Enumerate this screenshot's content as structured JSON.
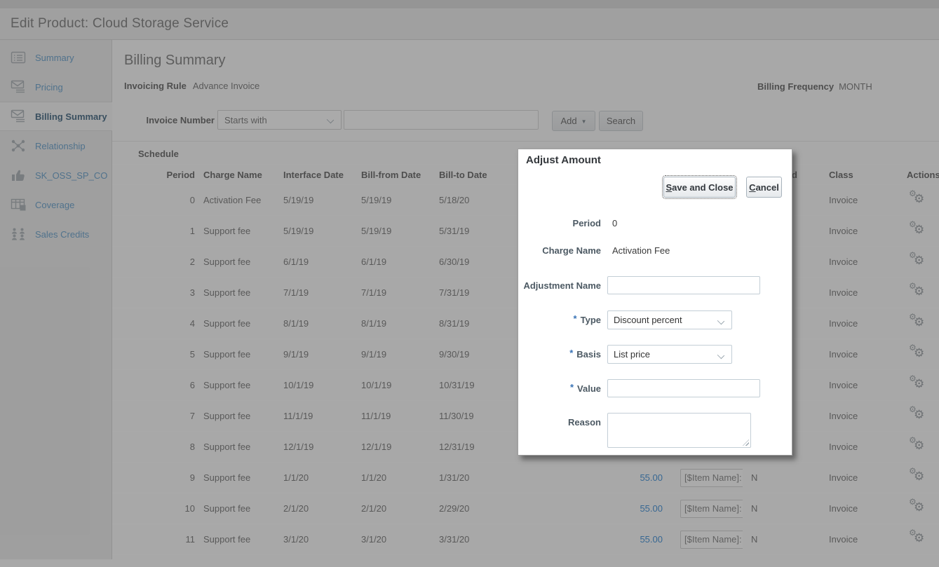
{
  "header": {
    "title": "Edit Product: Cloud Storage Service"
  },
  "sidebar": {
    "items": [
      {
        "label": "Summary",
        "icon": "summary-icon",
        "selected": false
      },
      {
        "label": "Pricing",
        "icon": "pricing-icon",
        "selected": false
      },
      {
        "label": "Billing Summary",
        "icon": "billing-summary-icon",
        "selected": true
      },
      {
        "label": "Relationship",
        "icon": "relationship-icon",
        "selected": false
      },
      {
        "label": "SK_OSS_SP_CO",
        "icon": "thumbs-up-icon",
        "selected": false
      },
      {
        "label": "Coverage",
        "icon": "coverage-icon",
        "selected": false
      },
      {
        "label": "Sales Credits",
        "icon": "sales-credits-icon",
        "selected": false
      }
    ]
  },
  "page": {
    "title": "Billing Summary",
    "invoicing_rule_label": "Invoicing Rule",
    "invoicing_rule_value": "Advance Invoice",
    "billing_frequency_label": "Billing Frequency",
    "billing_frequency_value": "MONTH"
  },
  "search": {
    "field_label": "Invoice Number",
    "operator_value": "Starts with",
    "input_value": "",
    "add_label": "Add",
    "search_label": "Search"
  },
  "schedule": {
    "section_title": "Schedule",
    "columns": {
      "period": "Period",
      "charge_name": "Charge Name",
      "interface_date": "Interface Date",
      "bill_from": "Bill-from Date",
      "bill_to": "Bill-to Date",
      "amount": "",
      "item": "",
      "invoiced": "Invoiced",
      "row_class": "Class",
      "actions": "Actions"
    },
    "rows": [
      {
        "period": "0",
        "charge": "Activation Fee",
        "interface_date": "5/19/19",
        "bill_from": "5/19/19",
        "bill_to": "5/18/20",
        "amount": "",
        "item": "",
        "invoiced": "",
        "row_class": "Invoice"
      },
      {
        "period": "1",
        "charge": "Support fee",
        "interface_date": "5/19/19",
        "bill_from": "5/19/19",
        "bill_to": "5/31/19",
        "amount": "",
        "item": "",
        "invoiced": "",
        "row_class": "Invoice"
      },
      {
        "period": "2",
        "charge": "Support fee",
        "interface_date": "6/1/19",
        "bill_from": "6/1/19",
        "bill_to": "6/30/19",
        "amount": "",
        "item": "",
        "invoiced": "",
        "row_class": "Invoice"
      },
      {
        "period": "3",
        "charge": "Support fee",
        "interface_date": "7/1/19",
        "bill_from": "7/1/19",
        "bill_to": "7/31/19",
        "amount": "",
        "item": "",
        "invoiced": "",
        "row_class": "Invoice"
      },
      {
        "period": "4",
        "charge": "Support fee",
        "interface_date": "8/1/19",
        "bill_from": "8/1/19",
        "bill_to": "8/31/19",
        "amount": "",
        "item": "",
        "invoiced": "",
        "row_class": "Invoice"
      },
      {
        "period": "5",
        "charge": "Support fee",
        "interface_date": "9/1/19",
        "bill_from": "9/1/19",
        "bill_to": "9/30/19",
        "amount": "",
        "item": "",
        "invoiced": "",
        "row_class": "Invoice"
      },
      {
        "period": "6",
        "charge": "Support fee",
        "interface_date": "10/1/19",
        "bill_from": "10/1/19",
        "bill_to": "10/31/19",
        "amount": "",
        "item": "",
        "invoiced": "",
        "row_class": "Invoice"
      },
      {
        "period": "7",
        "charge": "Support fee",
        "interface_date": "11/1/19",
        "bill_from": "11/1/19",
        "bill_to": "11/30/19",
        "amount": "",
        "item": "",
        "invoiced": "",
        "row_class": "Invoice"
      },
      {
        "period": "8",
        "charge": "Support fee",
        "interface_date": "12/1/19",
        "bill_from": "12/1/19",
        "bill_to": "12/31/19",
        "amount": "",
        "item": "",
        "invoiced": "",
        "row_class": "Invoice"
      },
      {
        "period": "9",
        "charge": "Support fee",
        "interface_date": "1/1/20",
        "bill_from": "1/1/20",
        "bill_to": "1/31/20",
        "amount": "55.00",
        "item": "[$Item Name]: S",
        "invoiced": "N",
        "row_class": "Invoice"
      },
      {
        "period": "10",
        "charge": "Support fee",
        "interface_date": "2/1/20",
        "bill_from": "2/1/20",
        "bill_to": "2/29/20",
        "amount": "55.00",
        "item": "[$Item Name]: S",
        "invoiced": "N",
        "row_class": "Invoice"
      },
      {
        "period": "11",
        "charge": "Support fee",
        "interface_date": "3/1/20",
        "bill_from": "3/1/20",
        "bill_to": "3/31/20",
        "amount": "55.00",
        "item": "[$Item Name]: S",
        "invoiced": "N",
        "row_class": "Invoice"
      }
    ]
  },
  "dialog": {
    "title": "Adjust Amount",
    "save_mnemonic": "S",
    "save_rest": "ave and Close",
    "cancel_mnemonic": "C",
    "cancel_rest": "ancel",
    "required_marker": "*",
    "period_label": "Period",
    "period_value": "0",
    "charge_label": "Charge Name",
    "charge_value": "Activation Fee",
    "adjustment_label": "Adjustment Name",
    "adjustment_value": "",
    "type_label": "Type",
    "type_value": "Discount percent",
    "basis_label": "Basis",
    "basis_value": "List price",
    "value_label": "Value",
    "value_value": "",
    "reason_label": "Reason",
    "reason_value": ""
  },
  "colors": {
    "link_blue": "#1878cf",
    "selected_nav_text": "#1d4869",
    "required_marker": "#3973b5",
    "dim_overlay": "rgba(85,85,85,0.5)"
  }
}
